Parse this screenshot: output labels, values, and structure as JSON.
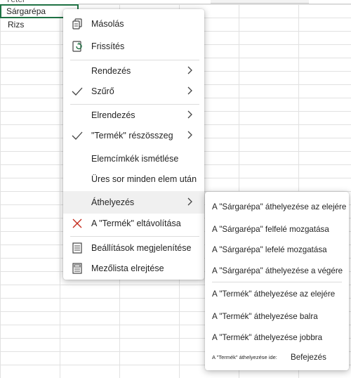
{
  "sheet": {
    "header_cell": "Tétel",
    "selected_cell": "Sárgarépa",
    "cell_below": "Rizs"
  },
  "context_menu": {
    "copy": "Másolás",
    "refresh": "Frissítés",
    "sort": "Rendezés",
    "filter": "Szűrő",
    "layout": "Elrendezés",
    "subtotal": "\"Termék\" részösszeg",
    "repeat_labels": "Elemcímkék ismétlése",
    "blank_row": "Üres sor minden elem után",
    "move": "Áthelyezés",
    "remove": "A \"Termék\" eltávolítása",
    "show_settings": "Beállítások megjelenítése",
    "hide_field_list": "Mezőlista elrejtése"
  },
  "submenu": {
    "move_to_start": "A \"Sárgarépa\" áthelyezése az elejére",
    "move_up": "A \"Sárgarépa\" felfelé mozgatása",
    "move_down": "A \"Sárgarépa\" lefelé mozgatása",
    "move_to_end": "A \"Sárgarépa\" áthelyezése a végére",
    "field_to_start": "A \"Termék\" áthelyezése az elejére",
    "field_left": "A \"Termék\" áthelyezése balra",
    "field_right": "A \"Termék\" áthelyezése jobbra",
    "field_to": "A \"Termék\" áthelyezése ide:",
    "finish": "Befejezés"
  },
  "icons": {
    "copy": "copy-icon",
    "refresh": "refresh-icon",
    "filter_check": "checkmark-icon",
    "subtotal_check": "checkmark-icon",
    "remove": "close-icon",
    "settings": "settings-panel-icon",
    "field_list": "field-list-icon"
  },
  "colors": {
    "selection_border": "#1f7244",
    "remove_icon": "#c42b1c",
    "refresh_icon": "#1f7244"
  }
}
